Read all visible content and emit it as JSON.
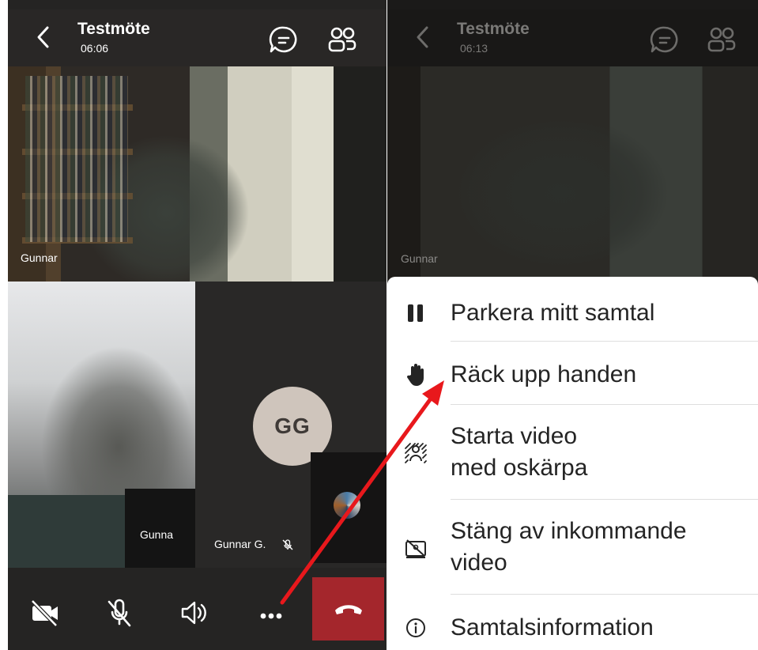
{
  "left_screen": {
    "title": "Testmöte",
    "time": "06:06",
    "participants": {
      "top_name": "Gunnar",
      "pip_name": "Gunna",
      "avatar_initials": "GG",
      "avatar_name": "Gunnar G."
    },
    "controls": {
      "camera": "video-off-icon",
      "mic": "mic-off-icon",
      "speaker": "speaker-icon",
      "more": "more-icon",
      "hangup": "hangup-icon"
    },
    "colors": {
      "hangup": "#a4262c",
      "avatar_bg": "#cfc5bc"
    }
  },
  "right_screen": {
    "title": "Testmöte",
    "time": "06:13",
    "participant_name": "Gunnar",
    "menu": {
      "items": [
        {
          "icon": "hold-icon",
          "label": "Parkera mitt samtal"
        },
        {
          "icon": "raise-hand-icon",
          "label": "Räck upp handen"
        },
        {
          "icon": "blur-background-icon",
          "label_line1": "Starta video",
          "label_line2": "med oskärpa"
        },
        {
          "icon": "incoming-video-off-icon",
          "label_line1": "Stäng av inkommande",
          "label_line2": "video"
        },
        {
          "icon": "info-icon",
          "label": "Samtalsinformation"
        }
      ]
    }
  },
  "annotation": {
    "arrow_color": "#e8181c"
  }
}
